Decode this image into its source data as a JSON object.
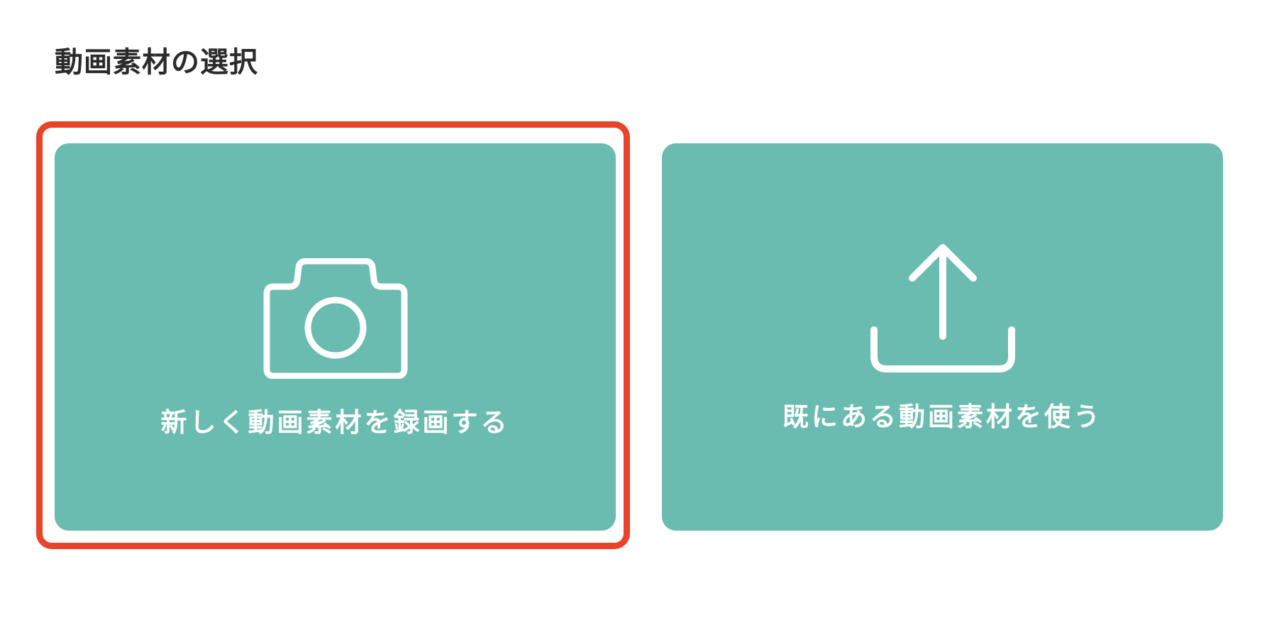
{
  "page": {
    "title": "動画素材の選択"
  },
  "options": [
    {
      "id": "record",
      "label": "新しく動画素材を録画する",
      "icon": "camera-icon",
      "selected": true
    },
    {
      "id": "upload",
      "label": "既にある動画素材を使う",
      "icon": "upload-icon",
      "selected": false
    }
  ],
  "colors": {
    "card_background": "#6abbb0",
    "selection_border": "#e8442a",
    "title_text": "#2b2b2b",
    "card_text": "#ffffff"
  }
}
